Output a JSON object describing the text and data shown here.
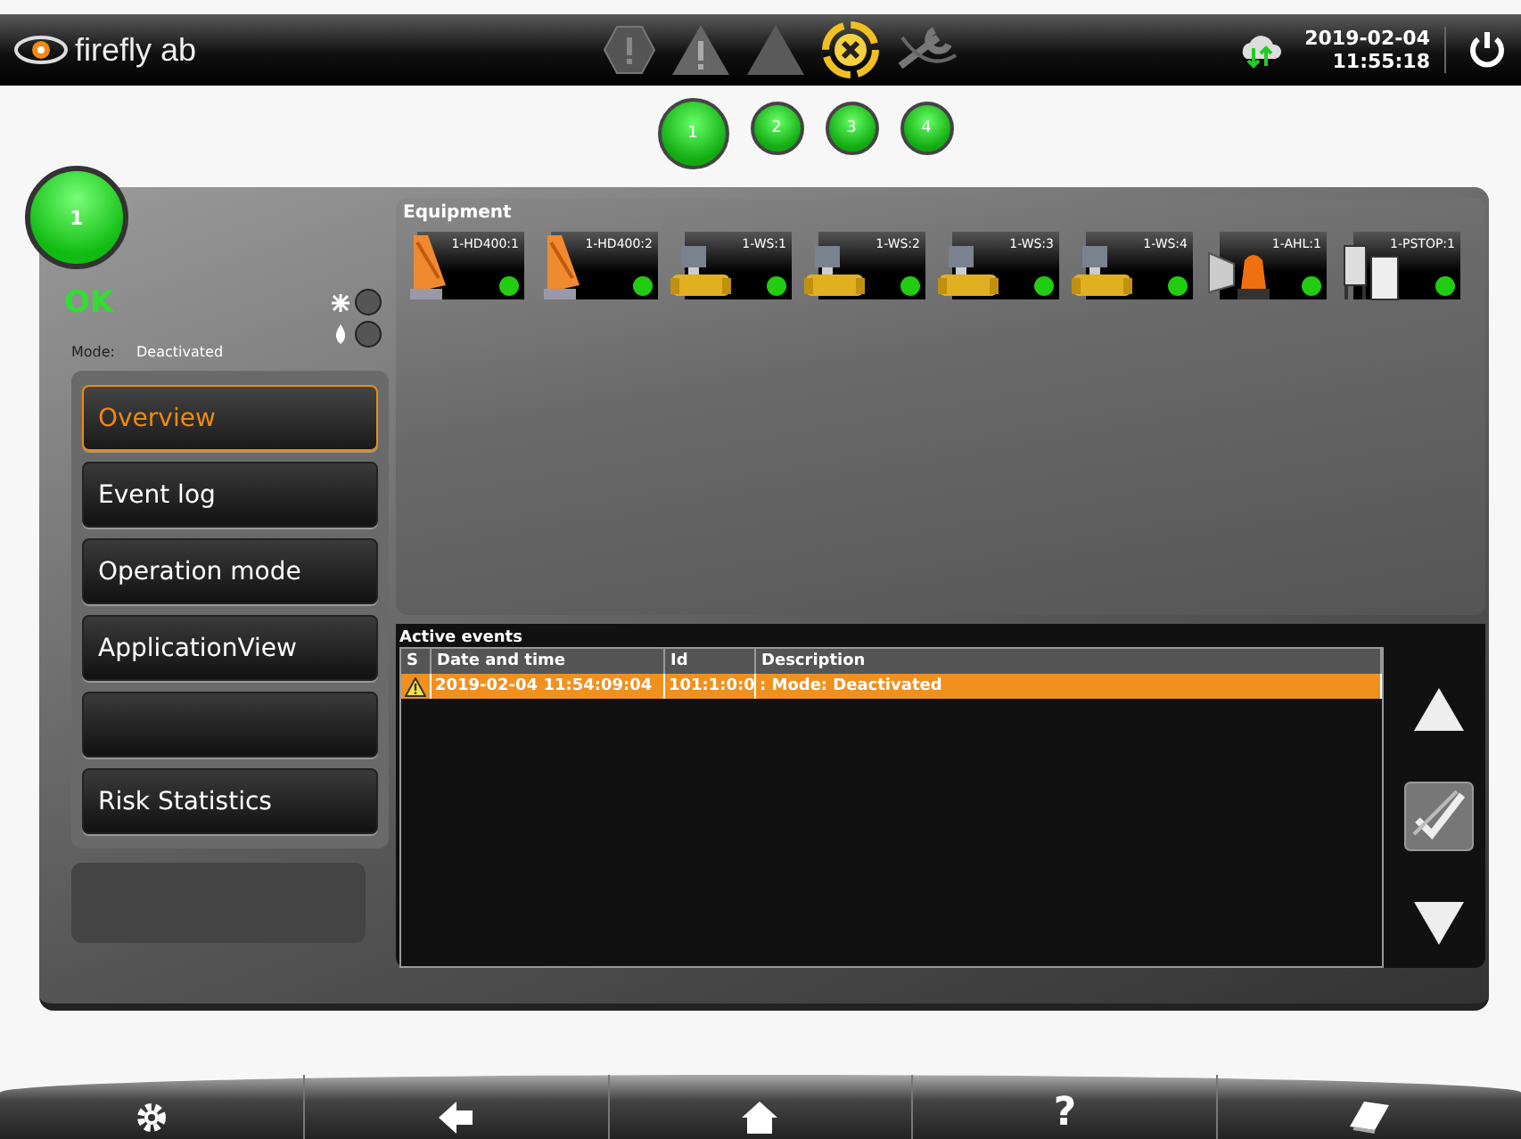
{
  "header": {
    "logo": "firefly ab",
    "status_icons": [
      {
        "kind": "fault",
        "active": false
      },
      {
        "kind": "warning",
        "active": false
      },
      {
        "kind": "alarm",
        "active": false
      },
      {
        "kind": "disabled",
        "active": true
      },
      {
        "kind": "service",
        "active": false
      }
    ],
    "date": "2019-02-04",
    "time": "11:55:18"
  },
  "sections": [
    {
      "label": "1",
      "selected": true
    },
    {
      "label": "2",
      "selected": false
    },
    {
      "label": "3",
      "selected": false
    },
    {
      "label": "4",
      "selected": false
    }
  ],
  "section": {
    "number": "1",
    "status": "OK",
    "indicators": [
      {
        "kind": "spark",
        "on": false
      },
      {
        "kind": "drop",
        "on": false
      }
    ],
    "mode_label": "Mode:",
    "mode": "Deactivated"
  },
  "nav": [
    {
      "label": "Overview",
      "selected": true
    },
    {
      "label": "Event log",
      "selected": false
    },
    {
      "label": "Operation mode",
      "selected": false
    },
    {
      "label": "ApplicationView",
      "selected": false
    },
    {
      "selected": false
    },
    {
      "label": "Risk Statistics",
      "selected": false
    }
  ],
  "equipment": {
    "title": "Equipment",
    "items": [
      {
        "label": "1-HD400:1",
        "kind": "detector",
        "color": "#22cc11"
      },
      {
        "label": "1-HD400:2",
        "kind": "detector",
        "color": "#22cc11"
      },
      {
        "label": "1-WS:1",
        "kind": "valve",
        "color": "#22cc11"
      },
      {
        "label": "1-WS:2",
        "kind": "valve",
        "color": "#22cc11"
      },
      {
        "label": "1-WS:3",
        "kind": "valve",
        "color": "#22cc11"
      },
      {
        "label": "1-WS:4",
        "kind": "valve",
        "color": "#22cc11"
      },
      {
        "label": "1-AHL:1",
        "kind": "alarm",
        "color": "#22cc11"
      },
      {
        "label": "1-PSTOP:1",
        "kind": "stop",
        "color": "#22cc11"
      }
    ]
  },
  "events": {
    "title": "Active events",
    "columns": [
      "S",
      "Date and time",
      "Id",
      "Description"
    ],
    "rows": [
      {
        "kind": "warning",
        "datetime": "2019-02-04 11:54:09:04",
        "id": "101:1:0:0",
        "description": ": Mode: Deactivated",
        "selected": true
      }
    ]
  },
  "footer": [
    {
      "kind": "settings"
    },
    {
      "kind": "back"
    },
    {
      "kind": "home"
    },
    {
      "kind": "help",
      "glyph": "?"
    },
    {
      "kind": "book"
    }
  ]
}
